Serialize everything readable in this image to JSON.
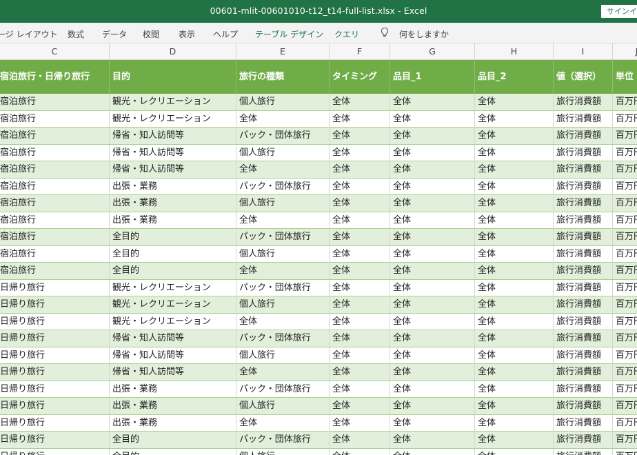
{
  "window": {
    "title": "00601-mlit-00601010-t12_t14-full-list.xlsx  -  Excel",
    "signin_label": "サインイン"
  },
  "ribbon": {
    "tabs": [
      "ージ レイアウト",
      "数式",
      "データ",
      "校閲",
      "表示",
      "ヘルプ",
      "テーブル デザイン",
      "クエリ"
    ],
    "search_prompt": "何をしますか"
  },
  "column_letters": [
    "C",
    "D",
    "E",
    "F",
    "G",
    "H",
    "I",
    "J"
  ],
  "table": {
    "headers": [
      "宿泊旅行・日帰り旅行",
      "目的",
      "旅行の種類",
      "タイミング",
      "品目_1",
      "品目_2",
      "値（選択）",
      "単位"
    ],
    "rows": [
      [
        "宿泊旅行",
        "観光・レクリエーション",
        "個人旅行",
        "全体",
        "全体",
        "全体",
        "旅行消費額",
        "百万円"
      ],
      [
        "宿泊旅行",
        "観光・レクリエーション",
        "全体",
        "全体",
        "全体",
        "全体",
        "旅行消費額",
        "百万円"
      ],
      [
        "宿泊旅行",
        "帰省・知人訪問等",
        "パック・団体旅行",
        "全体",
        "全体",
        "全体",
        "旅行消費額",
        "百万円"
      ],
      [
        "宿泊旅行",
        "帰省・知人訪問等",
        "個人旅行",
        "全体",
        "全体",
        "全体",
        "旅行消費額",
        "百万円"
      ],
      [
        "宿泊旅行",
        "帰省・知人訪問等",
        "全体",
        "全体",
        "全体",
        "全体",
        "旅行消費額",
        "百万円"
      ],
      [
        "宿泊旅行",
        "出張・業務",
        "パック・団体旅行",
        "全体",
        "全体",
        "全体",
        "旅行消費額",
        "百万円"
      ],
      [
        "宿泊旅行",
        "出張・業務",
        "個人旅行",
        "全体",
        "全体",
        "全体",
        "旅行消費額",
        "百万円"
      ],
      [
        "宿泊旅行",
        "出張・業務",
        "全体",
        "全体",
        "全体",
        "全体",
        "旅行消費額",
        "百万円"
      ],
      [
        "宿泊旅行",
        "全目的",
        "パック・団体旅行",
        "全体",
        "全体",
        "全体",
        "旅行消費額",
        "百万円"
      ],
      [
        "宿泊旅行",
        "全目的",
        "個人旅行",
        "全体",
        "全体",
        "全体",
        "旅行消費額",
        "百万円"
      ],
      [
        "宿泊旅行",
        "全目的",
        "全体",
        "全体",
        "全体",
        "全体",
        "旅行消費額",
        "百万円"
      ],
      [
        "日帰り旅行",
        "観光・レクリエーション",
        "パック・団体旅行",
        "全体",
        "全体",
        "全体",
        "旅行消費額",
        "百万円"
      ],
      [
        "日帰り旅行",
        "観光・レクリエーション",
        "個人旅行",
        "全体",
        "全体",
        "全体",
        "旅行消費額",
        "百万円"
      ],
      [
        "日帰り旅行",
        "観光・レクリエーション",
        "全体",
        "全体",
        "全体",
        "全体",
        "旅行消費額",
        "百万円"
      ],
      [
        "日帰り旅行",
        "帰省・知人訪問等",
        "パック・団体旅行",
        "全体",
        "全体",
        "全体",
        "旅行消費額",
        "百万円"
      ],
      [
        "日帰り旅行",
        "帰省・知人訪問等",
        "個人旅行",
        "全体",
        "全体",
        "全体",
        "旅行消費額",
        "百万円"
      ],
      [
        "日帰り旅行",
        "帰省・知人訪問等",
        "全体",
        "全体",
        "全体",
        "全体",
        "旅行消費額",
        "百万円"
      ],
      [
        "日帰り旅行",
        "出張・業務",
        "パック・団体旅行",
        "全体",
        "全体",
        "全体",
        "旅行消費額",
        "百万円"
      ],
      [
        "日帰り旅行",
        "出張・業務",
        "個人旅行",
        "全体",
        "全体",
        "全体",
        "旅行消費額",
        "百万円"
      ],
      [
        "日帰り旅行",
        "出張・業務",
        "全体",
        "全体",
        "全体",
        "全体",
        "旅行消費額",
        "百万円"
      ],
      [
        "日帰り旅行",
        "全目的",
        "パック・団体旅行",
        "全体",
        "全体",
        "全体",
        "旅行消費額",
        "百万円"
      ],
      [
        "日帰り旅行",
        "全目的",
        "個人旅行",
        "全体",
        "全体",
        "全体",
        "旅行消費額",
        "百万円"
      ]
    ]
  },
  "colors": {
    "titlebar": "#217346",
    "header_fill": "#70ad47",
    "band_fill": "#e2efda"
  }
}
